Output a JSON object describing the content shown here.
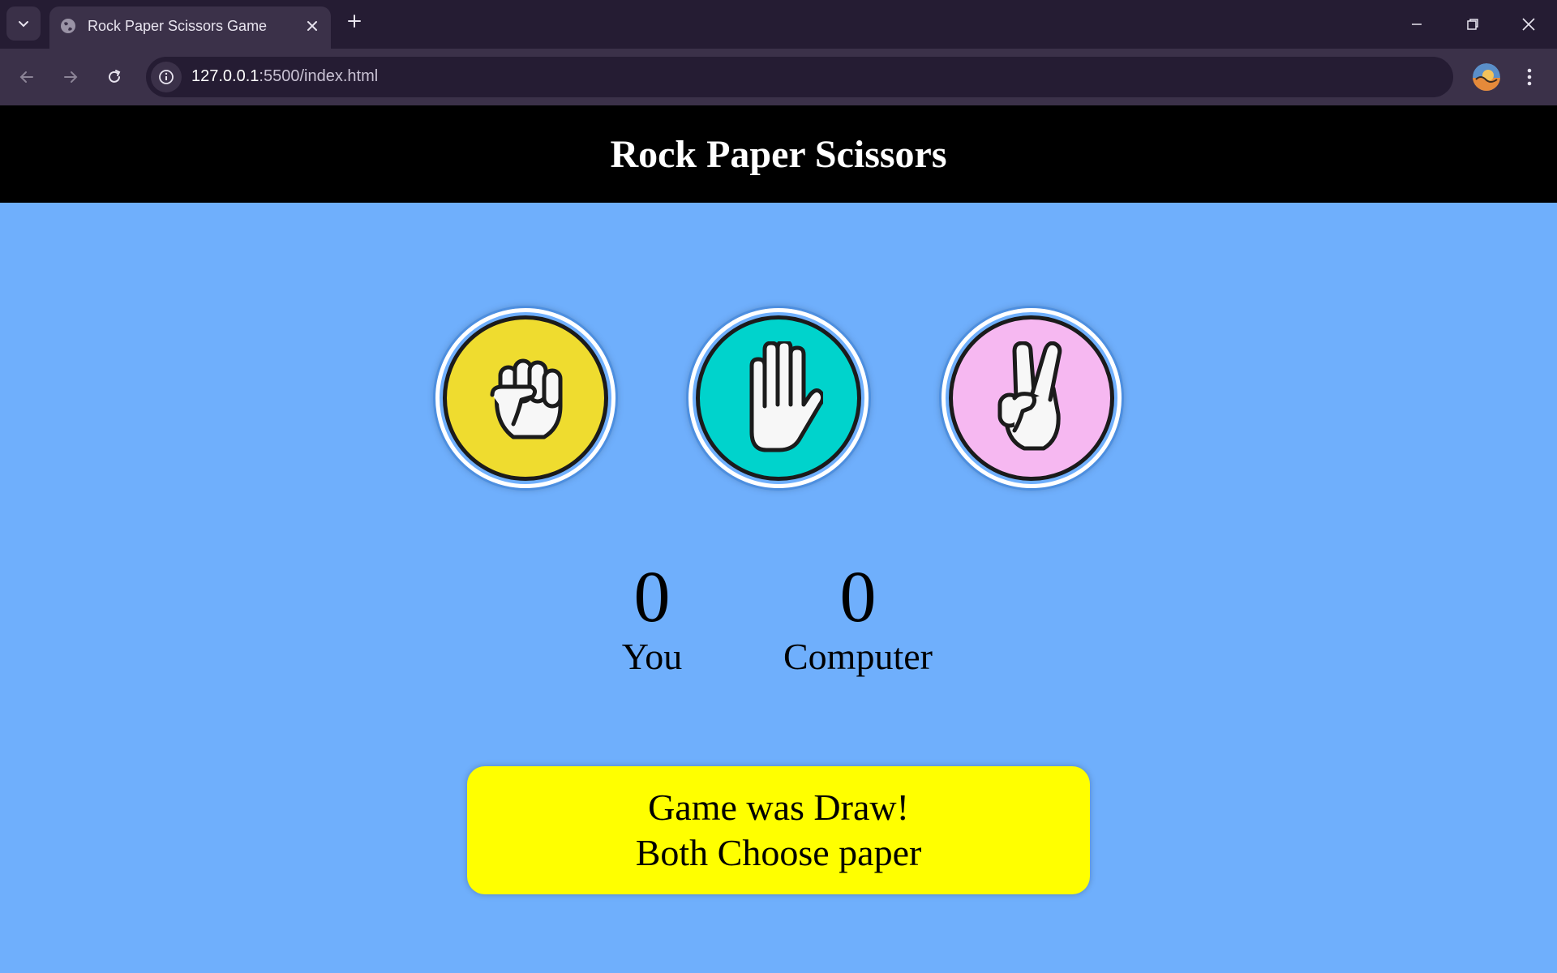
{
  "browser": {
    "tab_title": "Rock Paper Scissors Game",
    "url_host": "127.0.0.1",
    "url_path": ":5500/index.html"
  },
  "game": {
    "title": "Rock Paper Scissors",
    "choices": [
      {
        "name": "rock",
        "color": "#efdc2f",
        "icon": "fist-icon"
      },
      {
        "name": "paper",
        "color": "#00d3cc",
        "icon": "open-hand-icon"
      },
      {
        "name": "scissors",
        "color": "#f6b8f1",
        "icon": "victory-hand-icon"
      }
    ],
    "score": {
      "user_value": "0",
      "user_label": "You",
      "computer_value": "0",
      "computer_label": "Computer"
    },
    "message": {
      "line1": "Game was Draw!",
      "line2": "Both Choose paper",
      "color": "#ffff00"
    },
    "background_color": "#6faffc"
  }
}
